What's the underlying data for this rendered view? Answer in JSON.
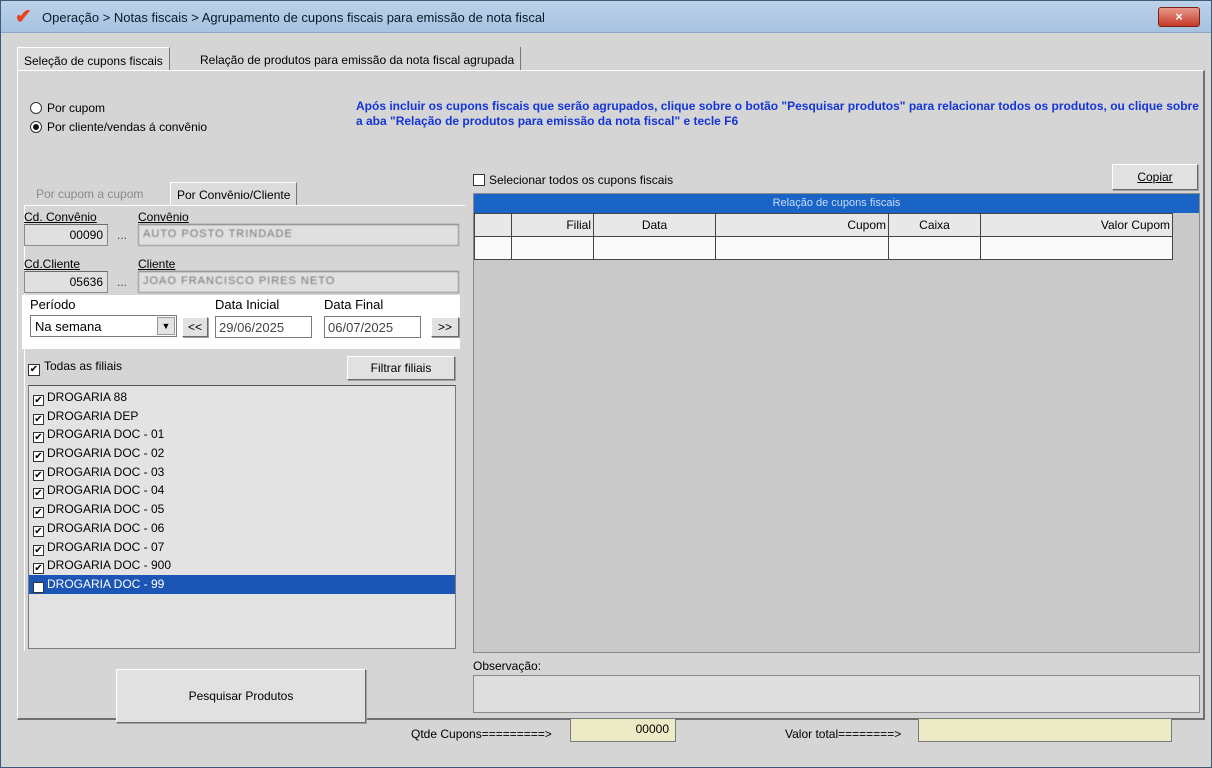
{
  "window": {
    "title": "Operação > Notas fiscais > Agrupamento de cupons fiscais para emissão de nota fiscal",
    "close_label": "×",
    "app_icon": "check-logo-icon"
  },
  "tabs": [
    {
      "label": "Seleção de cupons fiscais",
      "active": true
    },
    {
      "label": "Relação de produtos para emissão da nota fiscal agrupada",
      "active": false
    }
  ],
  "mode": {
    "options": [
      {
        "label": "Por cupom",
        "selected": false
      },
      {
        "label": "Por cliente/vendas á convênio",
        "selected": true
      }
    ]
  },
  "info_text": "Após incluir os cupons fiscais que serão agrupados, clique sobre o botão \"Pesquisar produtos\" para relacionar todos os produtos, ou clique sobre a aba \"Relação de produtos para emissão da nota fiscal\" e tecle F6",
  "subtabs": [
    {
      "label": "Por cupom a cupom",
      "active": false
    },
    {
      "label": "Por Convênio/Cliente",
      "active": true
    }
  ],
  "convenio": {
    "code_label": "Cd. Convênio",
    "code_value": "00090",
    "name_label": "Convênio",
    "name_value": "AUTO POSTO TRINDADE",
    "lookup_label": "..."
  },
  "cliente": {
    "code_label": "Cd.Cliente",
    "code_value": "05636",
    "name_label": "Cliente",
    "name_value": "JOAO FRANCISCO PIRES NETO",
    "lookup_label": "..."
  },
  "periodo": {
    "label": "Período",
    "selected": "Na semana",
    "prev_label": "<<",
    "next_label": ">>",
    "start_label": "Data Inicial",
    "start_value": "29/06/2025",
    "end_label": "Data Final",
    "end_value": "06/07/2025"
  },
  "filiais": {
    "all_label": "Todas as filiais",
    "all_checked": true,
    "filter_button": "Filtrar filiais",
    "items": [
      {
        "label": "DROGARIA 88",
        "checked": true
      },
      {
        "label": "DROGARIA DEP",
        "checked": true
      },
      {
        "label": "DROGARIA DOC - 01",
        "checked": true
      },
      {
        "label": "DROGARIA DOC - 02",
        "checked": true
      },
      {
        "label": "DROGARIA DOC - 03",
        "checked": true
      },
      {
        "label": "DROGARIA DOC - 04",
        "checked": true
      },
      {
        "label": "DROGARIA DOC - 05",
        "checked": true
      },
      {
        "label": "DROGARIA DOC - 06",
        "checked": true
      },
      {
        "label": "DROGARIA DOC - 07",
        "checked": true
      },
      {
        "label": "DROGARIA DOC - 900",
        "checked": true
      },
      {
        "label": "DROGARIA DOC - 99",
        "checked": true,
        "selected": true
      }
    ]
  },
  "select_all_label": "Selecionar todos os cupons fiscais",
  "copy_button": "Copiar",
  "cupons_table": {
    "title": "Relação de cupons fiscais",
    "columns": [
      "",
      "Filial",
      "Data",
      "Cupom",
      "Caixa",
      "Valor Cupom"
    ]
  },
  "observacao_label": "Observação:",
  "search_button": "Pesquisar Produtos",
  "qtde_label": "Qtde Cupons=========>",
  "qtde_value": "00000",
  "valor_label": "Valor total========>",
  "valor_value": ""
}
